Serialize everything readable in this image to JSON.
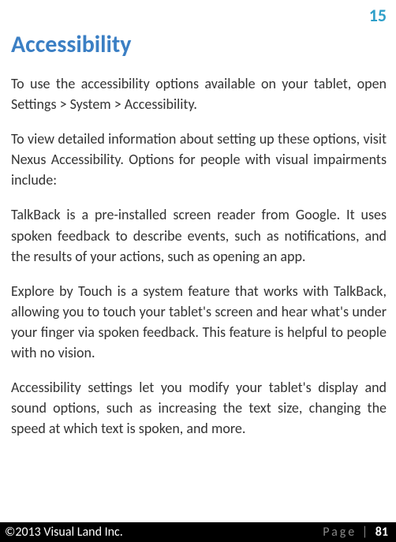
{
  "pageNumberTop": "15",
  "heading": "Accessibility",
  "paragraphs": [
    "To use the accessibility options available on your tablet, open   Settings > System > Accessibility.",
    "To view detailed information about setting up these options, visit Nexus Accessibility. Options for people with visual impairments include:",
    "TalkBack is a pre-installed screen reader from Google. It uses spoken feedback to describe events, such as notifications, and the results of your actions, such as opening an app.",
    "Explore by Touch is a system feature that works with TalkBack, allowing you to touch your tablet's screen and hear what's under your finger via spoken feedback. This feature is helpful to people with no vision.",
    "Accessibility settings let you modify your tablet's display and sound options, such as increasing the text size, changing the speed at which text is spoken, and more."
  ],
  "footer": {
    "copyright": "©2013 Visual Land Inc.",
    "pageLabel": "Page",
    "separator": " | ",
    "pageNum": "81"
  }
}
